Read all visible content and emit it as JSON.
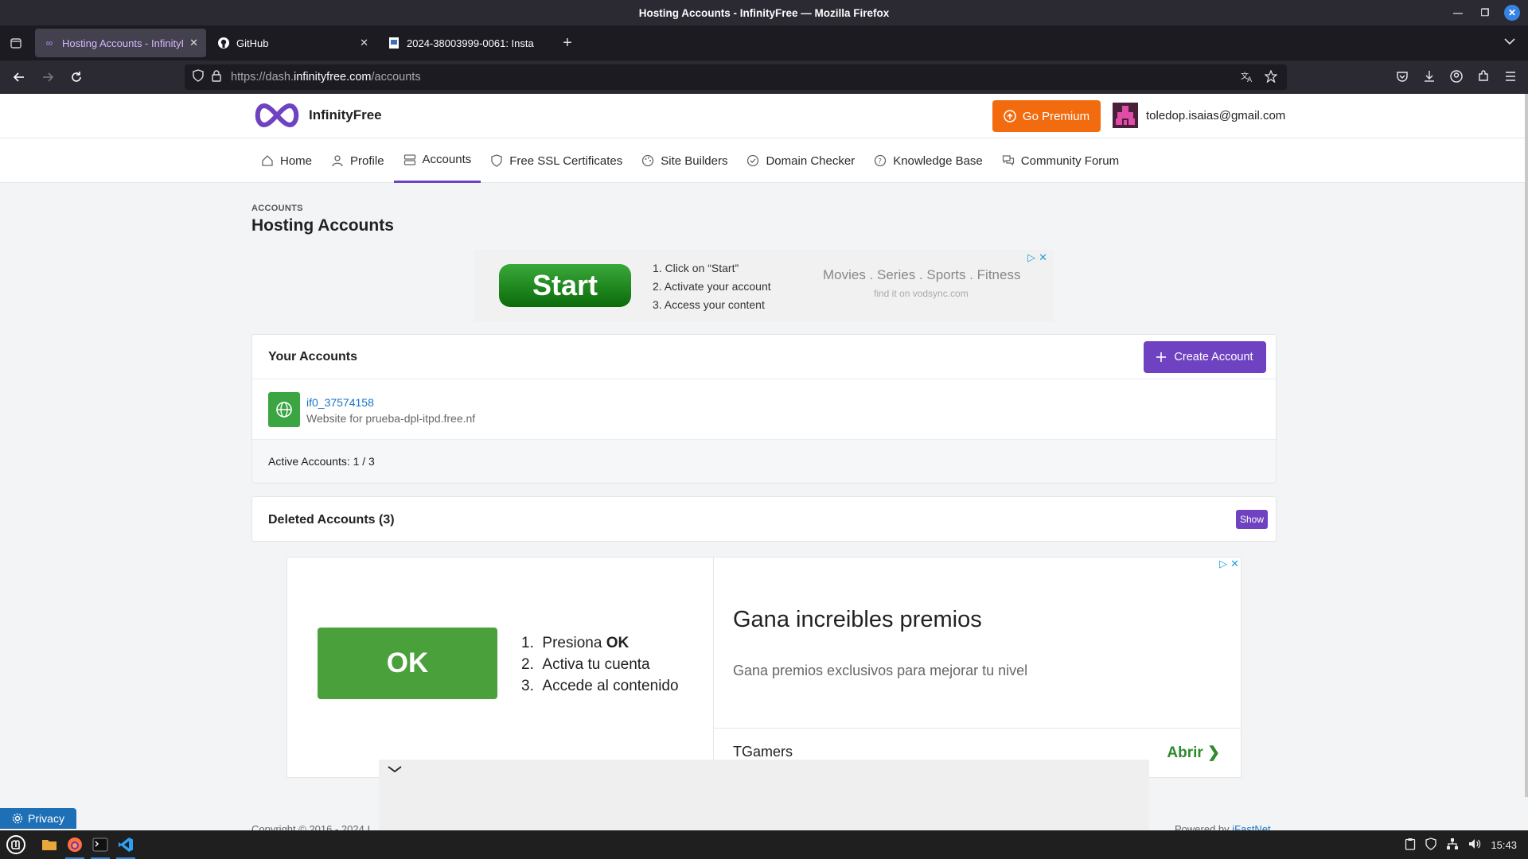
{
  "window": {
    "title": "Hosting Accounts - InfinityFree — Mozilla Firefox"
  },
  "tabs": [
    {
      "label": "Hosting Accounts - InfinityF",
      "active": true,
      "icon": "infinity-icon"
    },
    {
      "label": "GitHub",
      "active": false,
      "icon": "github-icon"
    },
    {
      "label": "2024-38003999-0061: Insta",
      "active": false,
      "icon": "document-icon"
    }
  ],
  "urlbar": {
    "prefix": "https://dash.",
    "domain": "infinityfree.com",
    "path": "/accounts"
  },
  "site": {
    "brand": "InfinityFree",
    "premium_label": "Go Premium",
    "user_email": "toledop.isaias@gmail.com",
    "accent_color": "#6f42c1",
    "premium_color": "#f26b0f"
  },
  "nav": {
    "items": [
      {
        "label": "Home",
        "icon": "home-icon"
      },
      {
        "label": "Profile",
        "icon": "user-icon"
      },
      {
        "label": "Accounts",
        "icon": "server-icon",
        "active": true
      },
      {
        "label": "Free SSL Certificates",
        "icon": "shield-icon"
      },
      {
        "label": "Site Builders",
        "icon": "palette-icon"
      },
      {
        "label": "Domain Checker",
        "icon": "check-circle-icon"
      },
      {
        "label": "Knowledge Base",
        "icon": "help-circle-icon"
      },
      {
        "label": "Community Forum",
        "icon": "chat-icon"
      }
    ]
  },
  "page": {
    "breadcrumb": "ACCOUNTS",
    "title": "Hosting Accounts"
  },
  "ad_top": {
    "button": "Start",
    "steps": [
      "1. Click on “Start”",
      "2. Activate your account",
      "3. Access your content"
    ],
    "categories": "Movies . Series . Sports . Fitness",
    "domain": "find it on vodsync.com"
  },
  "accounts": {
    "heading": "Your Accounts",
    "create_label": "Create Account",
    "items": [
      {
        "name": "if0_37574158",
        "desc": "Website for prueba-dpl-itpd.free.nf"
      }
    ],
    "footer": "Active Accounts: 1 / 3"
  },
  "deleted": {
    "heading": "Deleted Accounts (3)",
    "show_label": "Show"
  },
  "ad_bottom": {
    "button": "OK",
    "steps": [
      {
        "num": "1.",
        "text": "Presiona ",
        "bold": "OK"
      },
      {
        "num": "2.",
        "text": "Activa tu cuenta",
        "bold": ""
      },
      {
        "num": "3.",
        "text": "Accede al contenido",
        "bold": ""
      }
    ],
    "title": "Gana increibles premios",
    "subtitle": "Gana premios exclusivos para mejorar tu nivel",
    "brand": "TGamers",
    "open_label": "Abrir"
  },
  "footer": {
    "left": "Copyright © 2016 - 2024 I",
    "right_prefix": "Powered by ",
    "right_link": "iFastNet"
  },
  "privacy_label": "Privacy",
  "taskbar": {
    "clock": "15:43"
  }
}
